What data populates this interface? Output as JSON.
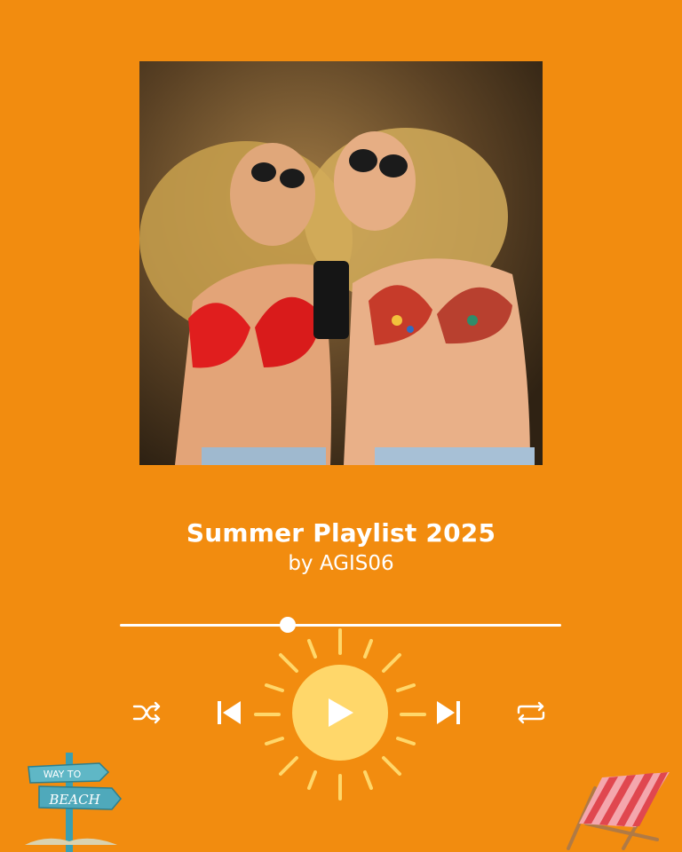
{
  "player": {
    "title": "Summer Playlist 2025",
    "artist": "by AGIS06",
    "progress_fraction": 0.38
  },
  "controls": {
    "shuffle": "shuffle-icon",
    "previous": "skip-previous-icon",
    "play": "play-icon",
    "next": "skip-next-icon",
    "repeat": "repeat-icon"
  },
  "decorations": {
    "sign_top": "WAY TO",
    "sign_bottom": "BEACH"
  },
  "colors": {
    "background": "#F28C0F",
    "sun": "#FFD76A",
    "text": "#FFFFFF"
  }
}
